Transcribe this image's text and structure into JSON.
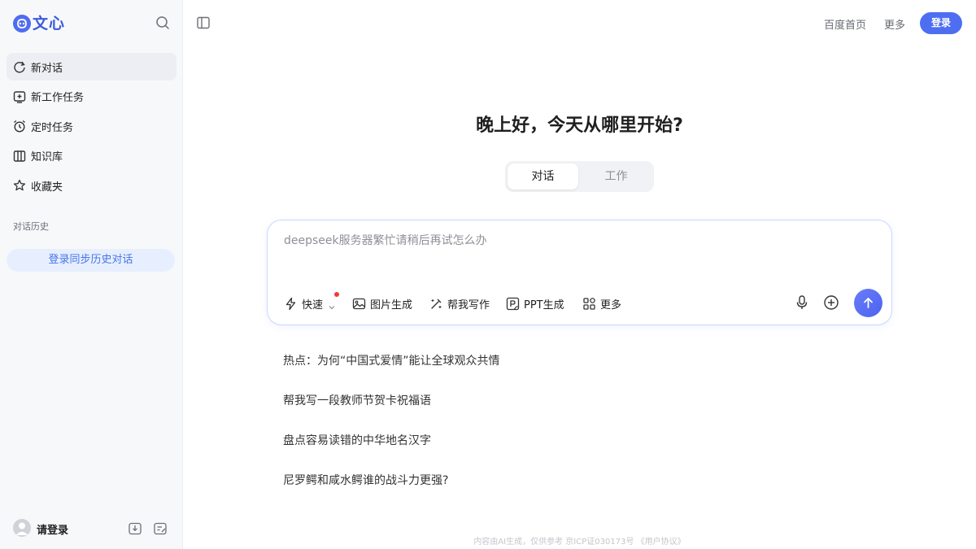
{
  "app": {
    "logo_text": "文心"
  },
  "sidebar": {
    "nav": [
      {
        "label": "新对话",
        "icon": "new-chat-icon",
        "active": true
      },
      {
        "label": "新工作任务",
        "icon": "new-task-icon",
        "active": false
      },
      {
        "label": "定时任务",
        "icon": "alarm-clock-icon",
        "active": false
      },
      {
        "label": "知识库",
        "icon": "library-icon",
        "active": false
      },
      {
        "label": "收藏夹",
        "icon": "star-icon",
        "active": false
      }
    ],
    "history_title": "对话历史",
    "sync_button": "登录同步历史对话",
    "user_label": "请登录"
  },
  "header": {
    "baidu_home": "百度首页",
    "more": "更多",
    "login": "登录"
  },
  "main": {
    "greeting": "晚上好，今天从哪里开始?",
    "modes": [
      "对话",
      "工作"
    ],
    "input_value": "deepseek服务器繁忙请稍后再试怎么办",
    "tools": [
      "快速",
      "图片生成",
      "帮我写作",
      "PPT生成",
      "更多"
    ],
    "suggestions": [
      "热点：为何“中国式爱情”能让全球观众共情",
      "帮我写一段教师节贺卡祝福语",
      "盘点容易读错的中华地名汉字",
      "尼罗鳄和咸水鳄谁的战斗力更强?"
    ],
    "footer": "内容由AI生成，仅供参考  京ICP证030173号  《用户协议》"
  },
  "colors": {
    "accent": "#4e6ef2",
    "sidebar_bg": "#f7f8fa",
    "sync_bg": "#e7efff",
    "sync_text": "#4874e8",
    "red_dot": "#f0393a"
  }
}
